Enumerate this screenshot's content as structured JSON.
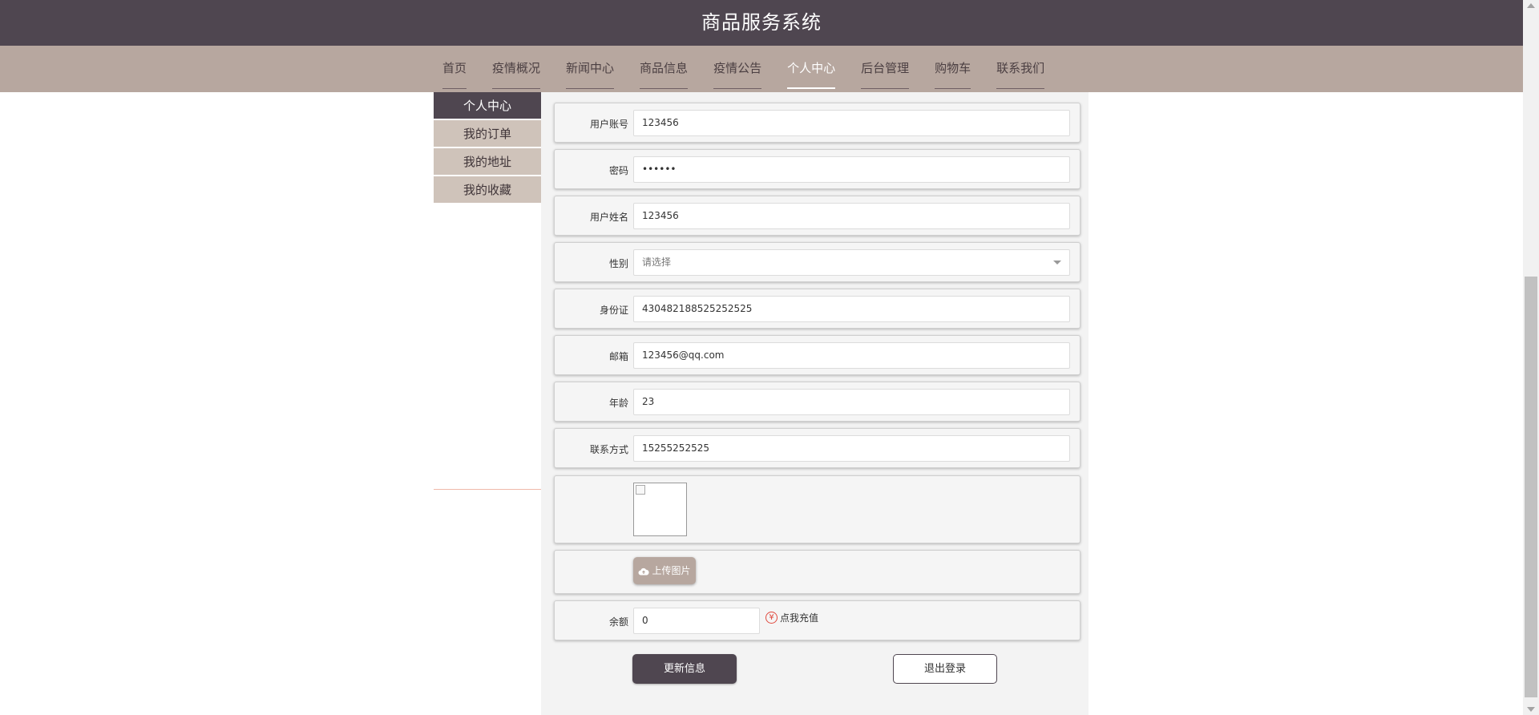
{
  "header": {
    "title": "商品服务系统"
  },
  "nav": {
    "items": [
      {
        "label": "首页"
      },
      {
        "label": "疫情概况"
      },
      {
        "label": "新闻中心"
      },
      {
        "label": "商品信息"
      },
      {
        "label": "疫情公告"
      },
      {
        "label": "个人中心"
      },
      {
        "label": "后台管理"
      },
      {
        "label": "购物车"
      },
      {
        "label": "联系我们"
      }
    ],
    "active": "个人中心"
  },
  "sidebar": {
    "items": [
      {
        "label": "个人中心"
      },
      {
        "label": "我的订单"
      },
      {
        "label": "我的地址"
      },
      {
        "label": "我的收藏"
      }
    ]
  },
  "form": {
    "username": {
      "label": "用户账号",
      "value": "123456"
    },
    "password": {
      "label": "密码",
      "value": "••••••"
    },
    "realname": {
      "label": "用户姓名",
      "value": "123456"
    },
    "gender": {
      "label": "性别",
      "placeholder": "请选择"
    },
    "idcard": {
      "label": "身份证",
      "value": "430482188525252525"
    },
    "email": {
      "label": "邮箱",
      "value": "123456@qq.com"
    },
    "age": {
      "label": "年龄",
      "value": "23"
    },
    "phone": {
      "label": "联系方式",
      "value": "15255252525"
    },
    "upload_label": "上传图片",
    "balance": {
      "label": "余额",
      "value": "0"
    },
    "recharge_label": "点我充值",
    "recharge_icon_text": "¥",
    "update_button": "更新信息",
    "logout_button": "退出登录"
  },
  "colors": {
    "header_bg": "#4f4650",
    "nav_bg": "#b7a79f",
    "sidebar_item_bg": "#cfc3ba",
    "accent_red": "#e04a3f"
  }
}
